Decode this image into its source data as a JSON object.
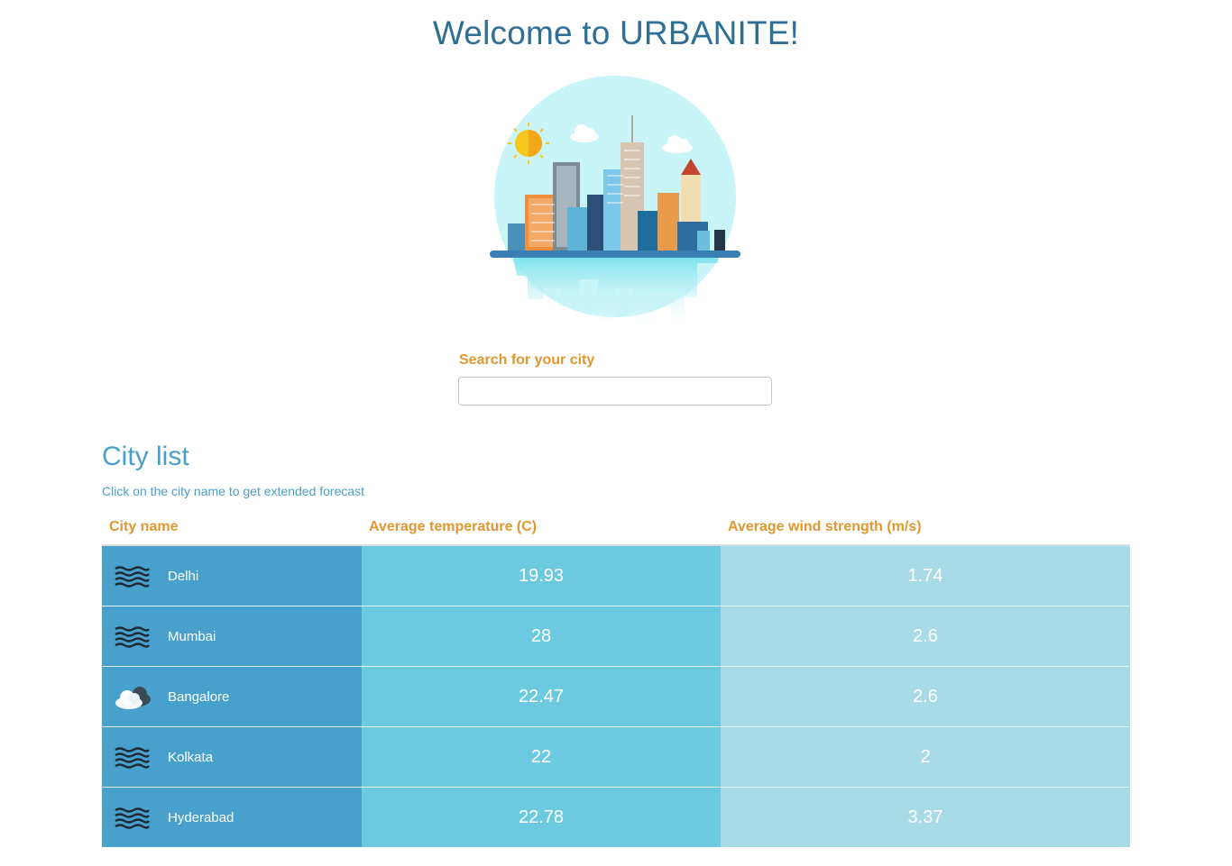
{
  "page": {
    "title": "Welcome to URBANITE!"
  },
  "hero": {
    "illustration": "city-skyline-illustration"
  },
  "search": {
    "label": "Search for your city",
    "value": "",
    "placeholder": ""
  },
  "city_list": {
    "title": "City list",
    "subtitle": "Click on the city name to get extended forecast",
    "columns": [
      "City name",
      "Average temperature (C)",
      "Average wind strength (m/s)"
    ],
    "rows": [
      {
        "icon": "mist-icon",
        "city": "Delhi",
        "temperature": "19.93",
        "wind": "1.74"
      },
      {
        "icon": "mist-icon",
        "city": "Mumbai",
        "temperature": "28",
        "wind": "2.6"
      },
      {
        "icon": "cloud-icon",
        "city": "Bangalore",
        "temperature": "22.47",
        "wind": "2.6"
      },
      {
        "icon": "mist-icon",
        "city": "Kolkata",
        "temperature": "22",
        "wind": "2"
      },
      {
        "icon": "mist-icon",
        "city": "Hyderabad",
        "temperature": "22.78",
        "wind": "3.37"
      }
    ]
  },
  "colors": {
    "title": "#2e6f94",
    "accent_orange": "#e0972e",
    "list_blue": "#4b9fc9",
    "col_name_bg": "#47a1cc",
    "col_temp_bg": "#6ccae0",
    "col_wind_bg": "#a9dae8"
  }
}
